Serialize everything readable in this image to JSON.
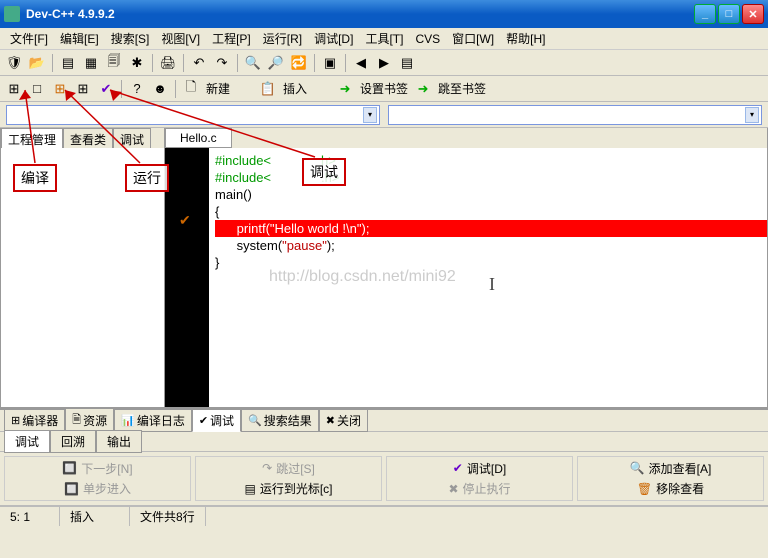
{
  "window": {
    "title": "Dev-C++ 4.9.9.2"
  },
  "menu": [
    "文件[F]",
    "编辑[E]",
    "搜索[S]",
    "视图[V]",
    "工程[P]",
    "运行[R]",
    "调试[D]",
    "工具[T]",
    "CVS",
    "窗口[W]",
    "帮助[H]"
  ],
  "toolbar2": {
    "new": "新建",
    "insert": "插入",
    "set_bookmark": "设置书签",
    "goto_bookmark": "跳至书签"
  },
  "side_tabs": [
    "工程管理",
    "查看类",
    "调试"
  ],
  "file_tab": "Hello.c",
  "code": {
    "l1": "#include<stdio.h>",
    "l1_mid": "调试",
    "l2": "#include<stdlib.h>",
    "l3": "main()",
    "l4": "{",
    "l5_indent": "      ",
    "l5_fn": "printf(",
    "l5_str": "\"Hello world !\\n\"",
    "l5_end": ");",
    "l6_indent": "      ",
    "l6_fn": "system(",
    "l6_str": "\"pause\"",
    "l6_end": ");",
    "l7": "}"
  },
  "watermark": "http://blog.csdn.net/mini92",
  "bottom_tabs1": [
    {
      "icon": "⊞",
      "label": "编译器"
    },
    {
      "icon": "🗎",
      "label": "资源"
    },
    {
      "icon": "📊",
      "label": "编译日志"
    },
    {
      "icon": "✔",
      "label": "调试"
    },
    {
      "icon": "🔍",
      "label": "搜索结果"
    },
    {
      "icon": "✖",
      "label": "关闭"
    }
  ],
  "bottom_tabs2": [
    "调试",
    "回溯",
    "输出"
  ],
  "debug_buttons": {
    "next_step": "下一步[N]",
    "step_into": "单步进入",
    "step_over": "跳过[S]",
    "run_to_cursor": "运行到光标[c]",
    "debug": "调试[D]",
    "stop": "停止执行",
    "add_watch": "添加查看[A]",
    "remove_watch": "移除查看"
  },
  "status": {
    "pos": "5: 1",
    "mode": "插入",
    "lines": "文件共8行"
  },
  "annotations": {
    "compile": "编译",
    "run": "运行",
    "debug": "调试"
  }
}
